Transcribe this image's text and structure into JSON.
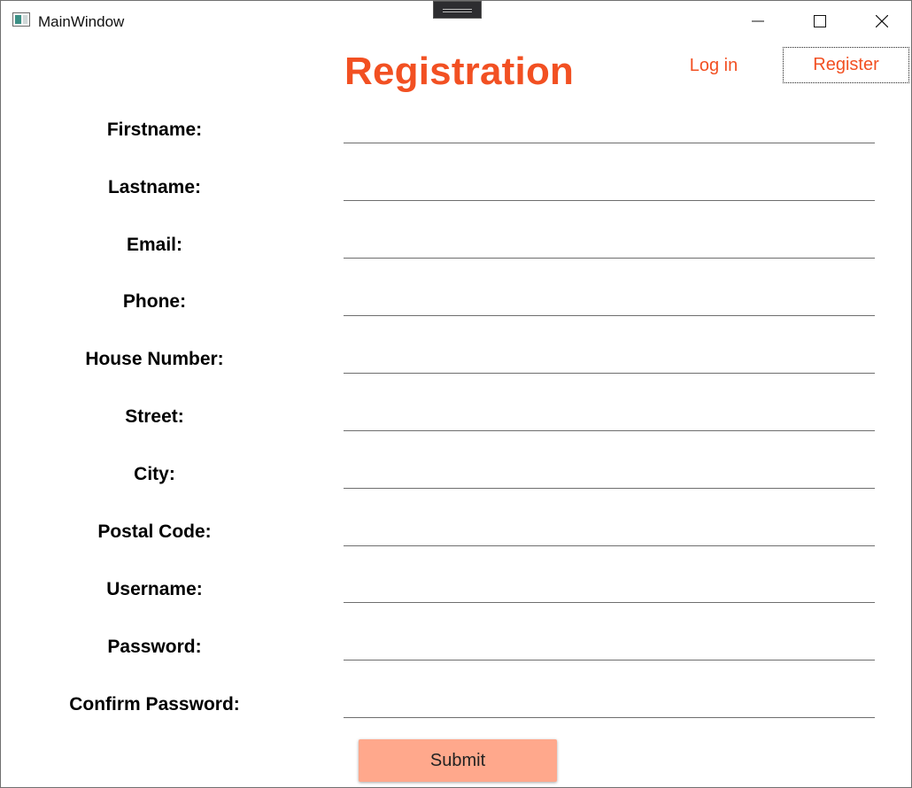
{
  "window": {
    "title": "MainWindow"
  },
  "header": {
    "title": "Registration",
    "nav": {
      "login": "Log in",
      "register": "Register"
    }
  },
  "form": {
    "fields": [
      {
        "label": "Firstname:",
        "value": ""
      },
      {
        "label": "Lastname:",
        "value": ""
      },
      {
        "label": "Email:",
        "value": ""
      },
      {
        "label": "Phone:",
        "value": ""
      },
      {
        "label": "House Number:",
        "value": ""
      },
      {
        "label": "Street:",
        "value": ""
      },
      {
        "label": "City:",
        "value": ""
      },
      {
        "label": "Postal Code:",
        "value": ""
      },
      {
        "label": "Username:",
        "value": ""
      },
      {
        "label": "Password:",
        "value": ""
      },
      {
        "label": "Confirm Password:",
        "value": ""
      }
    ],
    "submit_label": "Submit"
  },
  "colors": {
    "accent": "#f25022",
    "submit_bg": "#ffa88c"
  }
}
